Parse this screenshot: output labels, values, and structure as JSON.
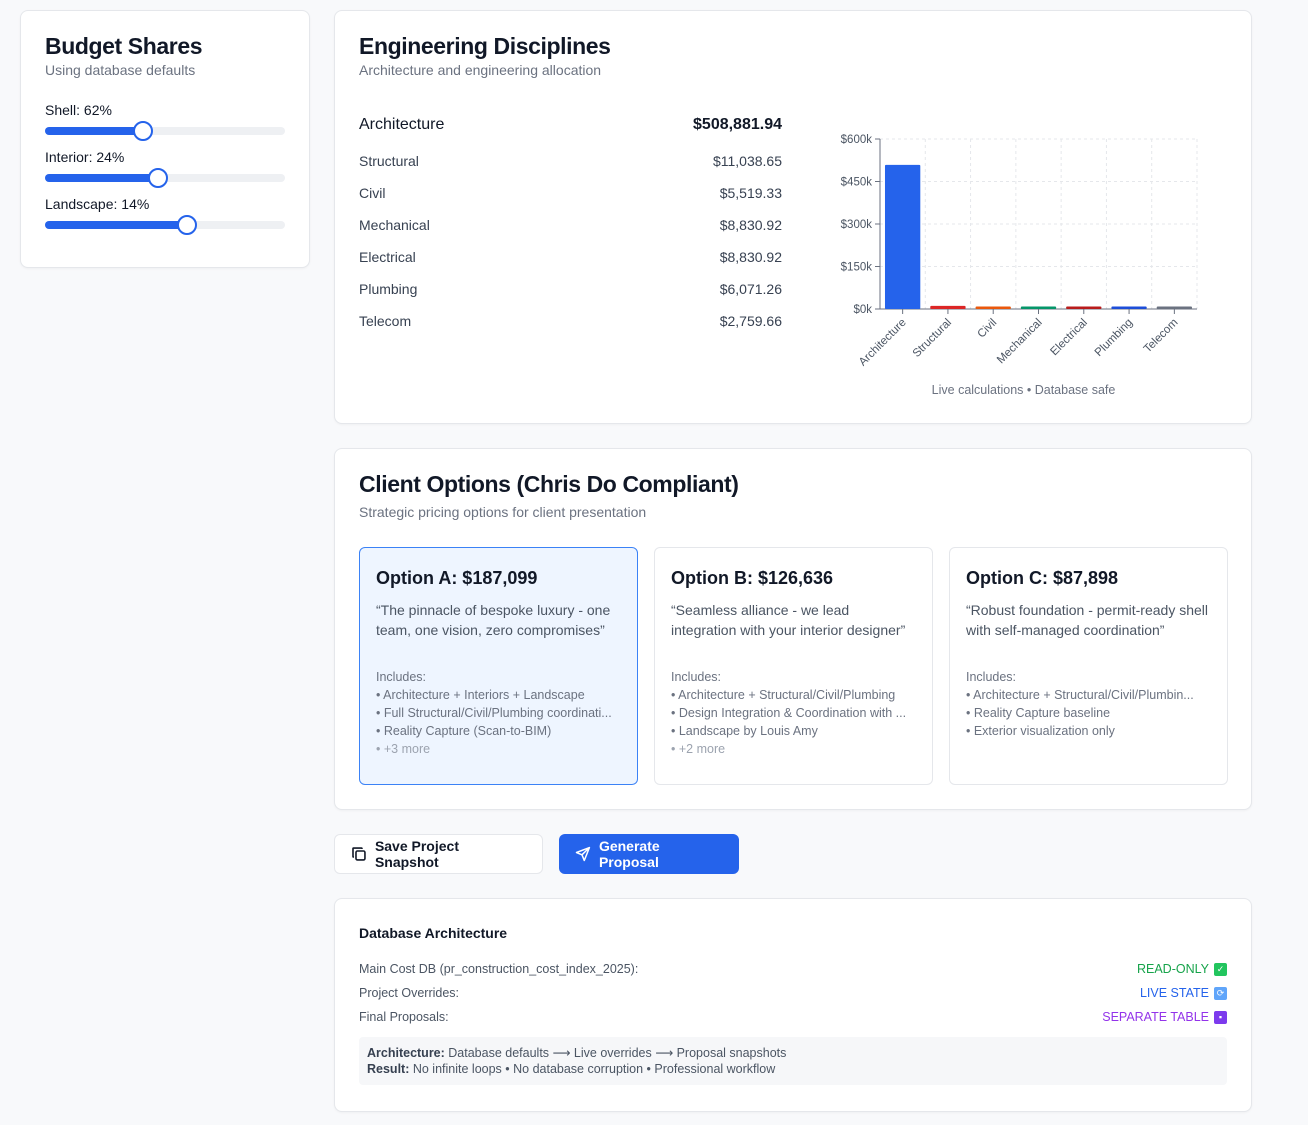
{
  "budget": {
    "title": "Budget Shares",
    "subtitle": "Using database defaults",
    "sliders": [
      {
        "label": "Shell: 62%",
        "value": 62
      },
      {
        "label": "Interior: 24%",
        "value": 24
      },
      {
        "label": "Landscape: 14%",
        "value": 14
      }
    ]
  },
  "engineering": {
    "title": "Engineering Disciplines",
    "subtitle": "Architecture and engineering allocation",
    "rows": [
      {
        "name": "Architecture",
        "amount": "$508,881.94"
      },
      {
        "name": "Structural",
        "amount": "$11,038.65"
      },
      {
        "name": "Civil",
        "amount": "$5,519.33"
      },
      {
        "name": "Mechanical",
        "amount": "$8,830.92"
      },
      {
        "name": "Electrical",
        "amount": "$8,830.92"
      },
      {
        "name": "Plumbing",
        "amount": "$6,071.26"
      },
      {
        "name": "Telecom",
        "amount": "$2,759.66"
      }
    ],
    "chart_caption": "Live calculations • Database safe"
  },
  "chart_data": {
    "type": "bar",
    "categories": [
      "Architecture",
      "Structural",
      "Civil",
      "Mechanical",
      "Electrical",
      "Plumbing",
      "Telecom"
    ],
    "values": [
      508881.94,
      11038.65,
      5519.33,
      8830.92,
      8830.92,
      6071.26,
      2759.66
    ],
    "colors": [
      "#2563eb",
      "#dc2626",
      "#ea580c",
      "#059669",
      "#b91c1c",
      "#1d4ed8",
      "#6b7280"
    ],
    "yticks": [
      "$0k",
      "$150k",
      "$300k",
      "$450k",
      "$600k"
    ],
    "ylim": [
      0,
      600000
    ],
    "grid": true
  },
  "options": {
    "title": "Client Options (Chris Do Compliant)",
    "subtitle": "Strategic pricing options for client presentation",
    "cards": [
      {
        "title": "Option A: $187,099",
        "quote": "“The pinnacle of bespoke luxury - one team, one vision, zero compromises”",
        "includes_label": "Includes:",
        "items": [
          "• Architecture + Interiors + Landscape",
          "• Full Structural/Civil/Plumbing coordinati...",
          "• Reality Capture (Scan-to-BIM)"
        ],
        "more": "• +3 more"
      },
      {
        "title": "Option B: $126,636",
        "quote": "“Seamless alliance - we lead integration with your interior designer”",
        "includes_label": "Includes:",
        "items": [
          "• Architecture + Structural/Civil/Plumbing",
          "• Design Integration & Coordination with ...",
          "• Landscape by Louis Amy"
        ],
        "more": "• +2 more"
      },
      {
        "title": "Option C: $87,898",
        "quote": "“Robust foundation - permit-ready shell with self-managed coordination”",
        "includes_label": "Includes:",
        "items": [
          "• Architecture + Structural/Civil/Plumbin...",
          "• Reality Capture baseline",
          "• Exterior visualization only"
        ],
        "more": ""
      }
    ]
  },
  "actions": {
    "save_label": "Save Project Snapshot",
    "generate_label": "Generate Proposal"
  },
  "database": {
    "title": "Database Architecture",
    "rows": [
      {
        "label": "Main Cost DB (pr_construction_cost_index_2025):",
        "status": "READ-ONLY",
        "color": "#16a34a",
        "icon": "check-icon"
      },
      {
        "label": "Project Overrides:",
        "status": "LIVE STATE",
        "color": "#2563eb",
        "icon": "refresh-icon"
      },
      {
        "label": "Final Proposals:",
        "status": "SEPARATE TABLE",
        "color": "#9333ea",
        "icon": "floppy-disk-icon"
      }
    ],
    "note_arch_label": "Architecture:",
    "note_arch_text": "Database defaults ⟶ Live overrides ⟶ Proposal snapshots",
    "note_result_label": "Result:",
    "note_result_text": "No infinite loops • No database corruption • Professional workflow"
  }
}
